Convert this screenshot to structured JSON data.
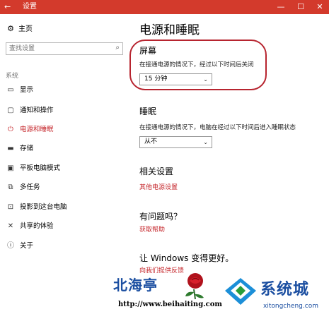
{
  "titlebar": {
    "back": "←",
    "title": "设置",
    "minimize": "—",
    "maximize": "☐",
    "close": "✕"
  },
  "sidebar": {
    "home_label": "主页",
    "search_placeholder": "查找设置",
    "section": "系统",
    "items": [
      {
        "label": "显示",
        "icon": "monitor-icon"
      },
      {
        "label": "通知和操作",
        "icon": "notification-icon"
      },
      {
        "label": "电源和睡眠",
        "icon": "power-icon",
        "active": true
      },
      {
        "label": "存储",
        "icon": "storage-icon"
      },
      {
        "label": "平板电脑模式",
        "icon": "tablet-icon"
      },
      {
        "label": "多任务",
        "icon": "multitask-icon"
      },
      {
        "label": "投影到这台电脑",
        "icon": "project-icon"
      },
      {
        "label": "共享的体验",
        "icon": "share-icon"
      },
      {
        "label": "关于",
        "icon": "info-icon"
      }
    ]
  },
  "main": {
    "title": "电源和睡眠",
    "screen": {
      "heading": "屏幕",
      "desc": "在接通电源的情况下，经过以下时间后关闭",
      "value": "15 分钟"
    },
    "sleep": {
      "heading": "睡眠",
      "desc": "在接通电源的情况下，电脑在经过以下时间后进入睡眠状态",
      "value": "从不"
    },
    "related": {
      "heading": "相关设置",
      "link": "其他电源设置"
    },
    "help": {
      "heading": "有问题吗？",
      "link": "获取帮助"
    },
    "improve": {
      "heading": "让 Windows 变得更好。",
      "link": "向我们提供反馈"
    }
  },
  "watermark": {
    "left_text": "北海亭",
    "left_url": "http://www.beihaiting.com",
    "brand_name": "系统城",
    "brand_url": "xitongcheng.com"
  },
  "colors": {
    "accent": "#d33a2c",
    "link": "#c5262b",
    "brand": "#1c4fa1"
  }
}
